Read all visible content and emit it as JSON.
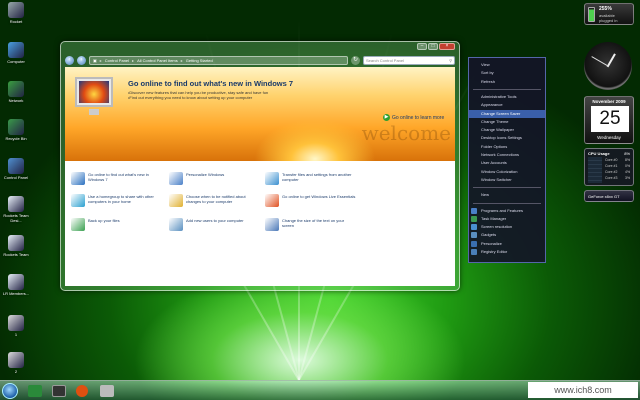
{
  "desktop_icons": [
    {
      "label": "Rocket",
      "color": "#9aa"
    },
    {
      "label": "Computer",
      "color": "#4aa0e0"
    },
    {
      "label": "Network",
      "color": "#3aa040"
    },
    {
      "label": "Recycle Bin",
      "color": "#3a9a4a"
    },
    {
      "label": "Control Panel",
      "color": "#5090d0"
    },
    {
      "label": "Rockets Team Desi...",
      "color": "#e8f0f8"
    },
    {
      "label": "Rockets Team",
      "color": "#e8f0f8"
    },
    {
      "label": "LR Members...",
      "color": "#e8f0f8"
    },
    {
      "label": "1",
      "color": "#ddd"
    },
    {
      "label": "2",
      "color": "#ddd"
    }
  ],
  "window": {
    "address": [
      "Control Panel",
      "All Control Panel Items",
      "Getting Started"
    ],
    "search_placeholder": "Search Control Panel",
    "banner": {
      "title": "Go online to find out what's new in Windows 7",
      "bullets": [
        "Discover new features that can help you be productive, stay safe and have fun",
        "Find out everything you need to know about setting up your computer"
      ],
      "learn_more": "Go online to learn more",
      "watermark": "welcome"
    },
    "tasks": [
      {
        "label": "Go online to find out what's new in Windows 7",
        "color": "#2a70c0"
      },
      {
        "label": "Personalize Windows",
        "color": "#4a80c8"
      },
      {
        "label": "Transfer files and settings from another computer",
        "color": "#3a90d0"
      },
      {
        "label": "Use a homegroup to share with other computers in your home",
        "color": "#2aa0d0"
      },
      {
        "label": "Choose when to be notified about changes to your computer",
        "color": "#e0b030"
      },
      {
        "label": "Go online to get Windows Live Essentials",
        "color": "#e05020"
      },
      {
        "label": "Back up your files",
        "color": "#3aa050"
      },
      {
        "label": "Add new users to your computer",
        "color": "#5a90c0"
      },
      {
        "label": "Change the size of the text on your screen",
        "color": "#4a78b8"
      }
    ]
  },
  "context_menu": {
    "items": [
      {
        "label": "View",
        "highlight": false,
        "icon": ""
      },
      {
        "label": "Sort by",
        "highlight": false,
        "icon": ""
      },
      {
        "label": "Refresh",
        "highlight": false,
        "icon": ""
      },
      {
        "label": "",
        "highlight": false,
        "icon": "separator"
      },
      {
        "label": "Administrative Tools",
        "highlight": false,
        "icon": ""
      },
      {
        "label": "Appearance",
        "highlight": false,
        "icon": ""
      },
      {
        "label": "Change Screen Saver",
        "highlight": true,
        "icon": ""
      },
      {
        "label": "Change Theme",
        "highlight": false,
        "icon": ""
      },
      {
        "label": "Change Wallpaper",
        "highlight": false,
        "icon": ""
      },
      {
        "label": "Desktop Icons Settings",
        "highlight": false,
        "icon": ""
      },
      {
        "label": "Folder Options",
        "highlight": false,
        "icon": ""
      },
      {
        "label": "Network Connections",
        "highlight": false,
        "icon": ""
      },
      {
        "label": "User Accounts",
        "highlight": false,
        "icon": ""
      },
      {
        "label": "Window Colorization",
        "highlight": false,
        "icon": ""
      },
      {
        "label": "Window Switcher",
        "highlight": false,
        "icon": ""
      },
      {
        "label": "",
        "highlight": false,
        "icon": "separator"
      },
      {
        "label": "New",
        "highlight": false,
        "icon": ""
      },
      {
        "label": "",
        "highlight": false,
        "icon": "separator"
      },
      {
        "label": "Programs and Features",
        "highlight": false,
        "icon": "#4a80c8"
      },
      {
        "label": "Task Manager",
        "highlight": false,
        "icon": "#3a9a50"
      },
      {
        "label": "Screen resolution",
        "highlight": false,
        "icon": "#4a90d0"
      },
      {
        "label": "Gadgets",
        "highlight": false,
        "icon": "#5a90c0"
      },
      {
        "label": "Personalize",
        "highlight": false,
        "icon": "#3a70b0"
      },
      {
        "label": "Registry Editor",
        "highlight": false,
        "icon": "#4a80b8"
      }
    ]
  },
  "gadgets": {
    "battery": {
      "percent": "255%",
      "line1": "available",
      "line2": "plugged in"
    },
    "calendar": {
      "month": "November 2009",
      "day": "25",
      "weekday": "Wednesday"
    },
    "cpu": {
      "title": "CPU Usage",
      "values": [
        "8%",
        "0%",
        "4%",
        "3%"
      ],
      "labels": [
        "Core #0",
        "Core #1",
        "Core #2",
        "Core #3"
      ]
    },
    "gpu": {
      "name": "GeForce x8xx GT"
    }
  },
  "taskbar": {
    "items": [
      "#2a8a3a",
      "#444",
      "#c84010"
    ]
  },
  "site_watermark": "www.ich8.com"
}
